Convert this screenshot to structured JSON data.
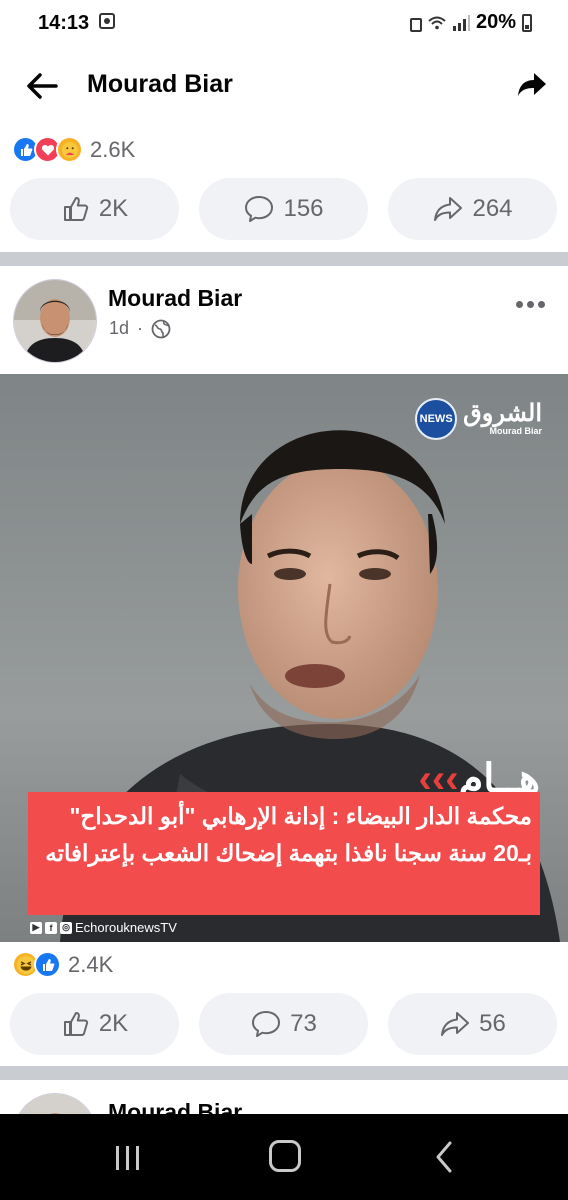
{
  "status_bar": {
    "time": "14:13",
    "battery": "20%"
  },
  "app_bar": {
    "title": "Mourad Biar",
    "back_icon": "arrow-left-icon",
    "share_icon": "share-arrow-icon"
  },
  "prev_post": {
    "reactions": [
      "like",
      "love",
      "care"
    ],
    "reaction_count": "2.6K",
    "actions": [
      {
        "icon": "thumbs-up-icon",
        "label": "2K"
      },
      {
        "icon": "comment-icon",
        "label": "156"
      },
      {
        "icon": "share-icon",
        "label": "264"
      }
    ]
  },
  "post": {
    "author": "Mourad Biar",
    "time": "1d",
    "separator": "·",
    "privacy_icon": "globe-icon",
    "image": {
      "brand_name": "الشروق",
      "brand_sub": "Mourad Biar",
      "news_badge": "NEWS",
      "tag": "هــام",
      "tag_arrows": "›››",
      "headline": "محكمة الدار البيضاء : إدانة الإرهابي \"أبو الدحداح\" بـ20 سنة سجنا نافذا بتهمة إضحاك الشعب بإعترافاته",
      "channel": "EchorouknewsTV"
    },
    "reactions": [
      "haha",
      "like"
    ],
    "reaction_count": "2.4K",
    "actions": [
      {
        "icon": "thumbs-up-icon",
        "label": "2K"
      },
      {
        "icon": "comment-icon",
        "label": "73"
      },
      {
        "icon": "share-icon",
        "label": "56"
      }
    ]
  },
  "next_post": {
    "author": "Mourad Biar"
  },
  "colors": {
    "facebook_blue": "#1877f2",
    "love_red": "#f33e58",
    "headline_red": "#f34c4c",
    "button_bg": "#f0f2f5",
    "muted_text": "#65676b"
  }
}
